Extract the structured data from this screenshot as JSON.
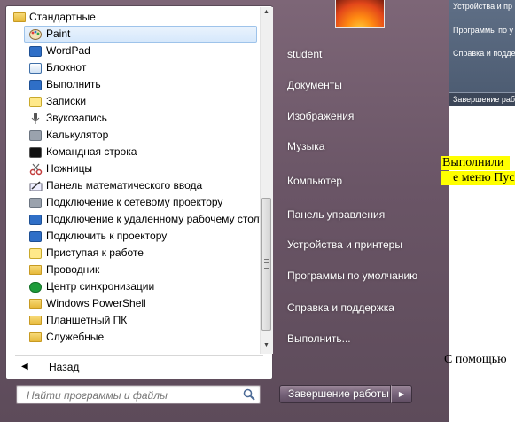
{
  "programs_menu": {
    "folder": "Стандартные",
    "items": [
      {
        "label": "Paint",
        "icon": "paint-icon"
      },
      {
        "label": "WordPad",
        "icon": "wordpad-icon"
      },
      {
        "label": "Блокнот",
        "icon": "notepad-icon"
      },
      {
        "label": "Выполнить",
        "icon": "run-icon"
      },
      {
        "label": "Записки",
        "icon": "sticky-notes-icon"
      },
      {
        "label": "Звукозапись",
        "icon": "microphone-icon"
      },
      {
        "label": "Калькулятор",
        "icon": "calculator-icon"
      },
      {
        "label": "Командная строка",
        "icon": "command-prompt-icon"
      },
      {
        "label": "Ножницы",
        "icon": "scissors-icon"
      },
      {
        "label": "Панель математического ввода",
        "icon": "math-input-icon"
      },
      {
        "label": "Подключение к сетевому проектору",
        "icon": "network-projector-icon"
      },
      {
        "label": "Подключение к удаленному рабочему столу",
        "icon": "remote-desktop-icon"
      },
      {
        "label": "Подключить к проектору",
        "icon": "projector-icon"
      },
      {
        "label": "Приступая к работе",
        "icon": "getting-started-icon"
      },
      {
        "label": "Проводник",
        "icon": "explorer-folder-icon"
      },
      {
        "label": "Центр синхронизации",
        "icon": "sync-center-icon"
      },
      {
        "label": "Windows PowerShell",
        "icon": "folder-icon"
      },
      {
        "label": "Планшетный ПК",
        "icon": "folder-icon"
      },
      {
        "label": "Служебные",
        "icon": "folder-icon"
      }
    ],
    "selected_index": 0,
    "back_label": "Назад"
  },
  "search": {
    "placeholder": "Найти программы и файлы"
  },
  "right_column": {
    "items": [
      "student",
      "Документы",
      "Изображения",
      "Музыка",
      "Компьютер",
      "Панель управления",
      "Устройства и принтеры",
      "Программы по умолчанию",
      "Справка и поддержка",
      "Выполнить..."
    ]
  },
  "shutdown": {
    "label": "Завершение работы"
  },
  "background": {
    "menu_items": [
      "Устройства и пр",
      "Программы по у",
      "Справка и подде"
    ],
    "shutdown_label": "Завершение работ",
    "doc_line1": "Выполнили",
    "doc_line2": "е меню Пус",
    "doc_line3": "С помощью"
  }
}
